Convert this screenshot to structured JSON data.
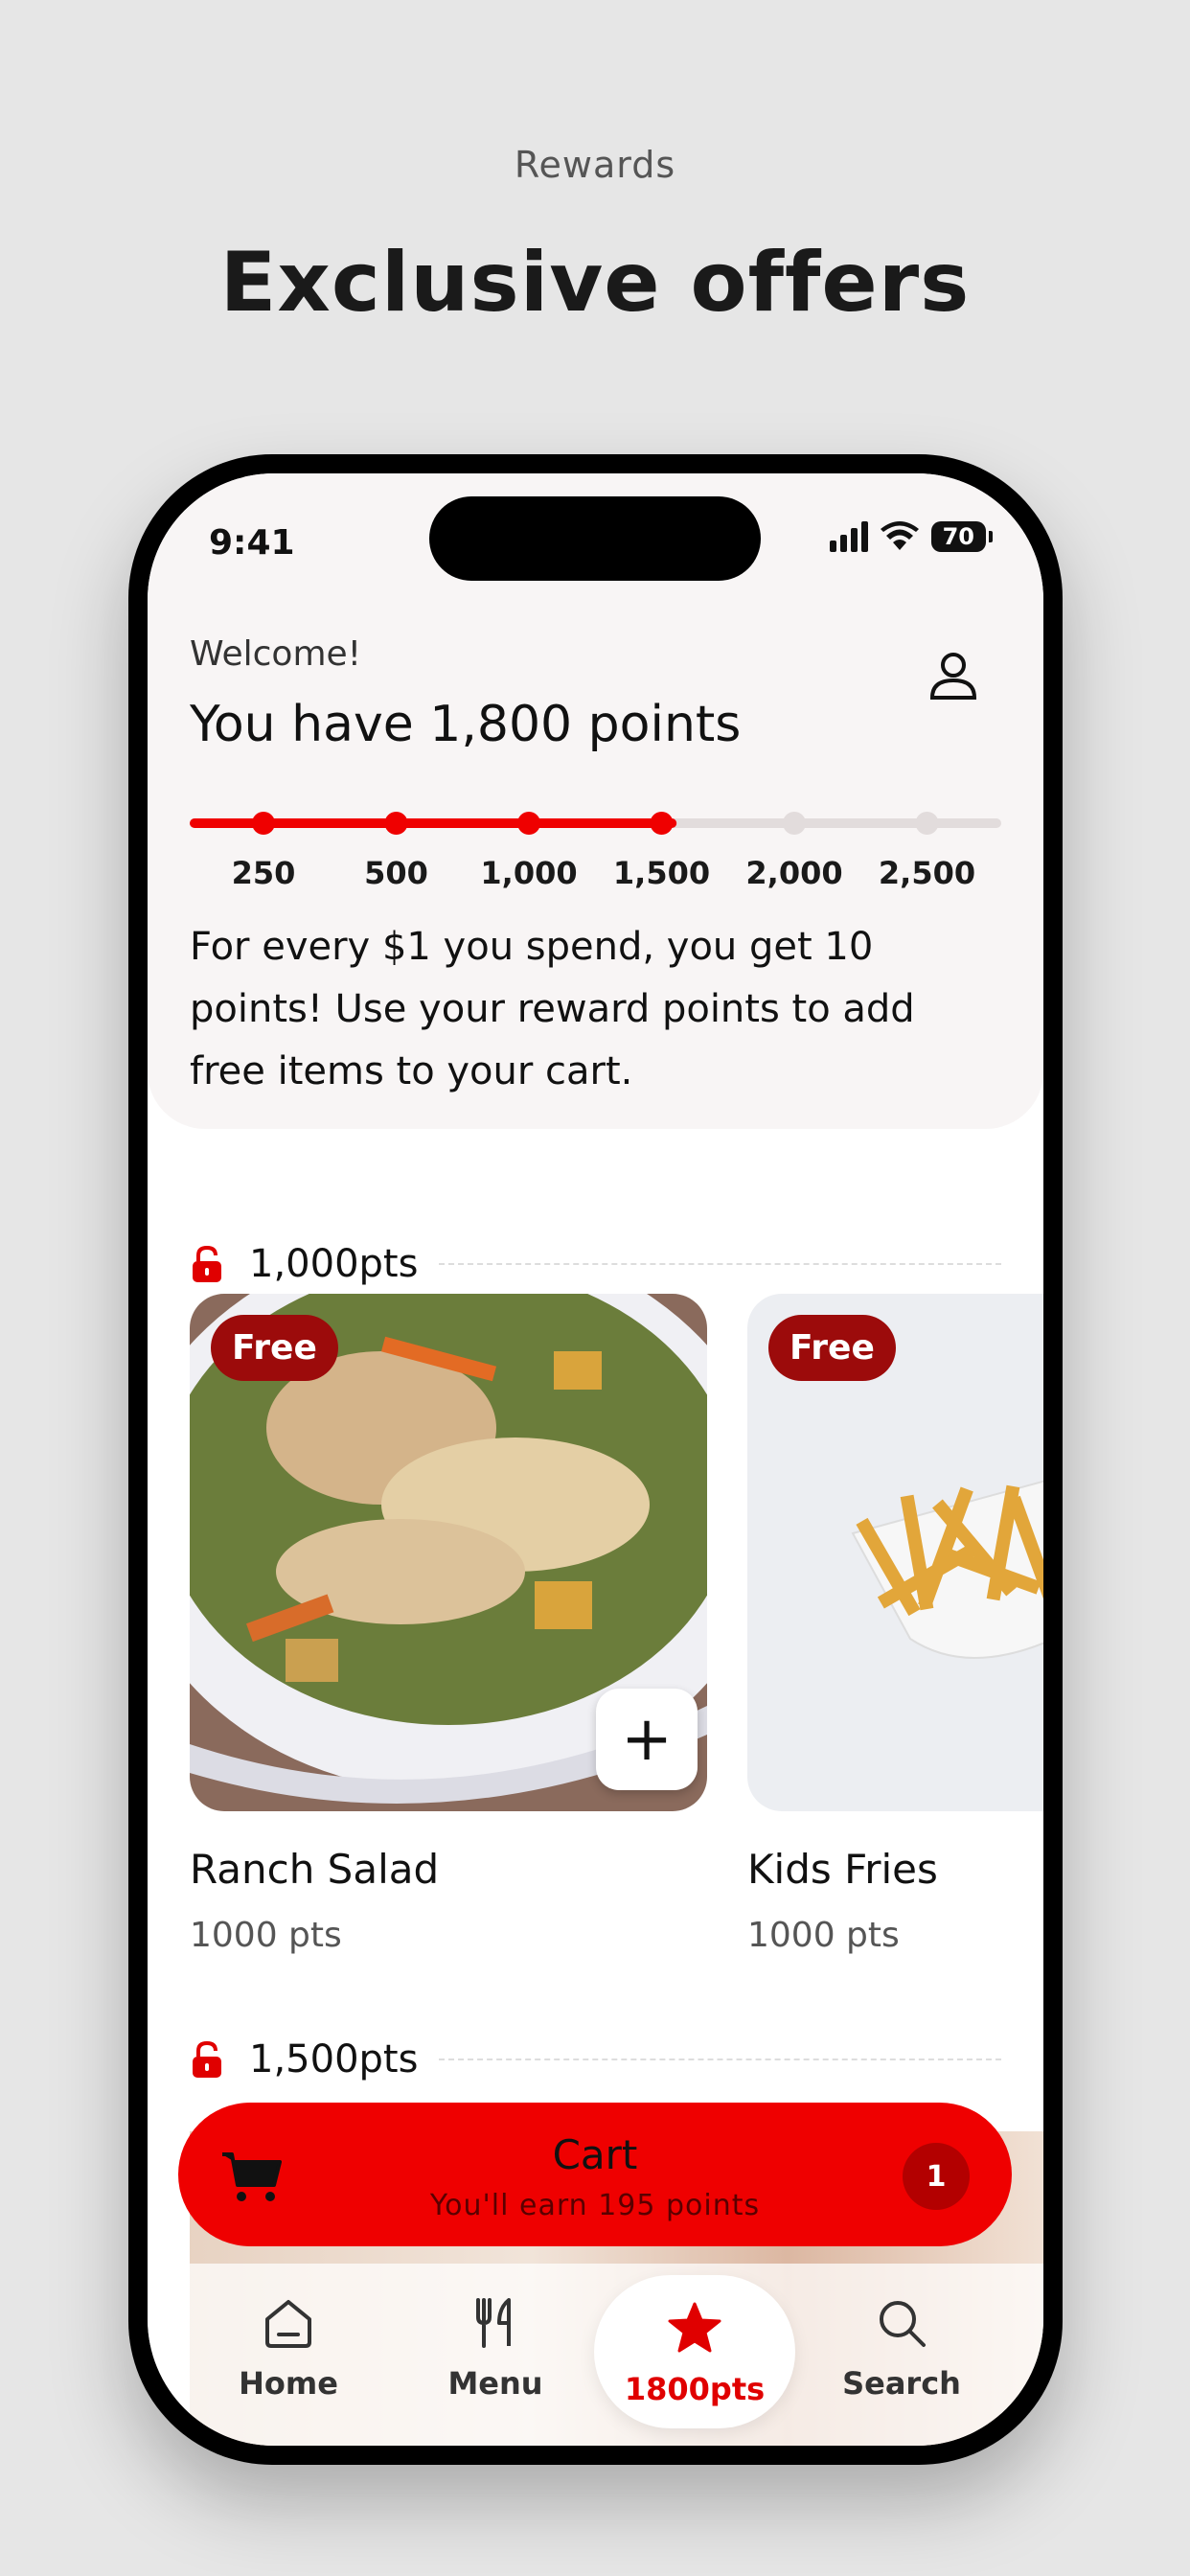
{
  "page": {
    "eyebrow": "Rewards",
    "headline": "Exclusive offers"
  },
  "status_bar": {
    "time": "9:41",
    "battery": "70"
  },
  "header": {
    "welcome": "Welcome!",
    "points_title": "You have 1,800 points",
    "progress_fraction": 0.6,
    "milestones": [
      "250",
      "500",
      "1,000",
      "1,500",
      "2,000",
      "2,500"
    ],
    "info": "For every $1 you spend, you get 10 points! Use your reward points to add free items to your cart."
  },
  "sections": [
    {
      "label": "1,000pts",
      "items": [
        {
          "badge": "Free",
          "name": "Ranch Salad",
          "price": "1000 pts"
        },
        {
          "badge": "Free",
          "name": "Kids Fries",
          "price": "1000 pts"
        }
      ]
    },
    {
      "label": "1,500pts"
    }
  ],
  "cart": {
    "title": "Cart",
    "subtitle": "You'll earn 195 points",
    "count": "1"
  },
  "tabs": [
    {
      "label": "Home",
      "icon": "home-icon"
    },
    {
      "label": "Menu",
      "icon": "utensils-icon"
    },
    {
      "label": "1800pts",
      "icon": "star-icon"
    },
    {
      "label": "Search",
      "icon": "search-icon"
    }
  ],
  "colors": {
    "accent": "#ef0000",
    "badge": "#9c0b0b",
    "track": "#e2dcdc"
  }
}
